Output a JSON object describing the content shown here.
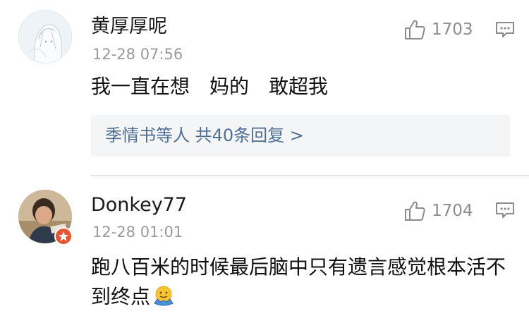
{
  "comments": [
    {
      "username": "黄厚厚呢",
      "time": "12-28 07:56",
      "like_count": "1703",
      "content": "我一直在想　妈的　敢超我",
      "reply_summary": "季情书等人 共40条回复 >"
    },
    {
      "username": "Donkey77",
      "time": "12-28 01:01",
      "like_count": "1704",
      "content": "跑八百米的时候最后脑中只有遗言感觉根本活不到终点"
    }
  ],
  "colors": {
    "link": "#4f6f95",
    "muted": "#9a9a9a",
    "reply_bg": "#f4f5f7",
    "badge": "#e8542f"
  },
  "icons": {
    "like": "thumbs-up-icon",
    "reply": "comment-bubble-icon",
    "emoji": "shrug-emoji-icon",
    "badge": "verified-badge-icon"
  }
}
